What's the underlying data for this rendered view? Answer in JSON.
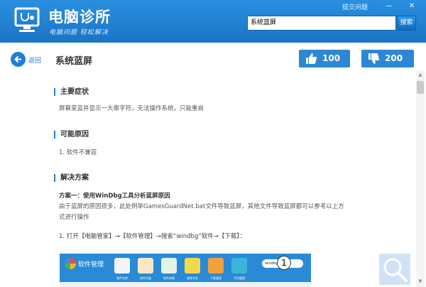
{
  "app": {
    "title": "电脑诊所",
    "slogan": "电脑问题 轻松解决",
    "feedback_label": "提交问题",
    "minimize_glyph": "—",
    "close_glyph": "✕"
  },
  "search": {
    "value": "系统蓝屏",
    "button_label": "搜索"
  },
  "header": {
    "back_label": "返回",
    "title": "系统蓝屏",
    "like_count": "100",
    "dislike_count": "200"
  },
  "sections": {
    "symptom": {
      "heading": "主要症状",
      "text": "屏幕变蓝并显示一大串字符，无法操作系统，只能重启"
    },
    "cause": {
      "heading": "可能原因",
      "text": "1. 软件不兼容"
    },
    "solution": {
      "heading": "解决方案",
      "plan_title": "方案一：使用WinDbg工具分析蓝屏原因",
      "plan_text_1": "由于蓝屏的原因很多，此处例举GamesGuardNet.bat文件导致蓝屏，其他文件导致蓝屏都可以参考以上方",
      "plan_text_2": "式进行操作",
      "step_1": "1. 打开【电脑管家】→【软件管理】→搜索“windbg”软件→【下载】："
    }
  },
  "embedded_screenshot": {
    "title": "软件管理",
    "search_value": "windbg",
    "marker": "1",
    "tile_labels": [
      "软件仓库",
      "软件升级",
      "软件卸载",
      "游戏专区",
      "下载管理",
      "手机管理"
    ]
  },
  "colors": {
    "brand_blue": "#1e7fd2",
    "vote_button": "#2d87d4"
  },
  "icons": {
    "logo": "monitor-stethoscope-icon",
    "back": "arrow-left-icon",
    "like": "thumbs-up-icon",
    "dislike": "thumbs-down-icon",
    "zoom": "magnifier-icon"
  }
}
